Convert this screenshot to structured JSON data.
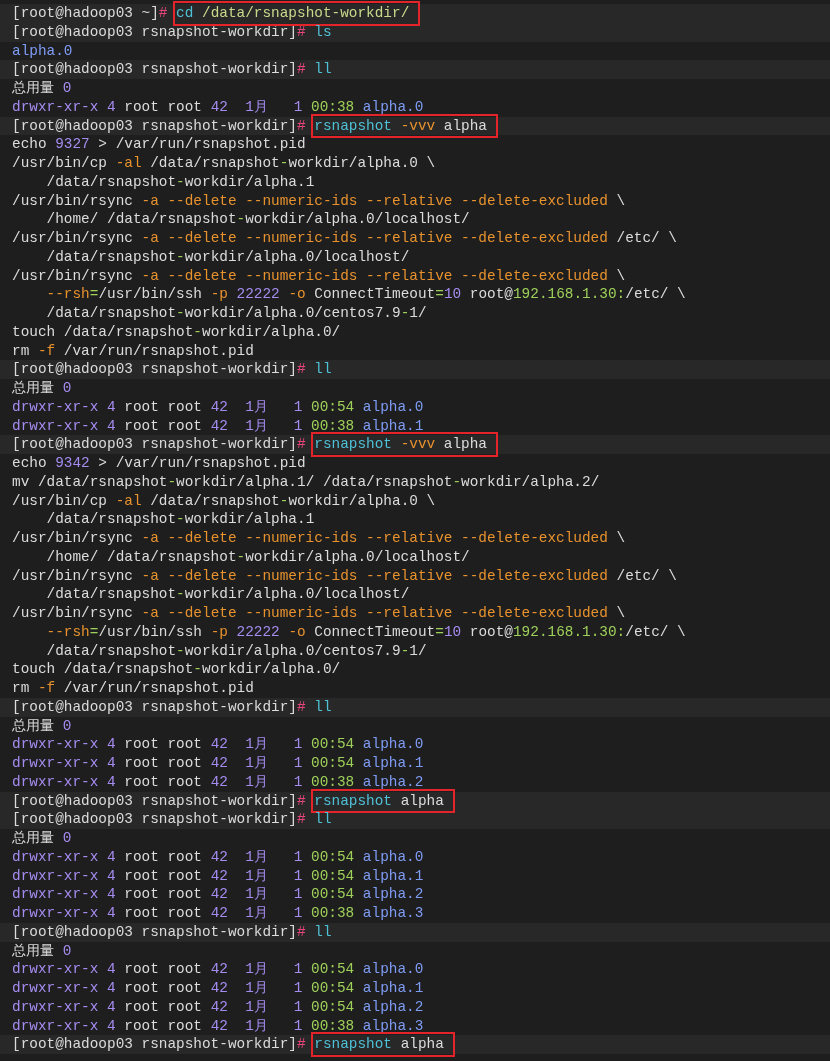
{
  "terminal": {
    "lines": [
      {
        "kind": "prompt",
        "prompt": "[root@hadoop03 ~]",
        "symbol": "#",
        "highlighted": true,
        "command": [
          {
            "text": "cd",
            "color": "#4fc1d6"
          },
          {
            "text": " /data/rsnapshot-workdir/",
            "color": "#c9d98c"
          }
        ]
      },
      {
        "kind": "prompt",
        "prompt": "[root@hadoop03 rsnapshot-workdir]",
        "symbol": "#",
        "highlighted": false,
        "command": [
          {
            "text": "ls",
            "color": "#4fc1d6"
          }
        ]
      },
      {
        "kind": "output",
        "segments": [
          {
            "text": "alpha.0",
            "color": "#7f9cf5"
          }
        ]
      },
      {
        "kind": "prompt",
        "prompt": "[root@hadoop03 rsnapshot-workdir]",
        "symbol": "#",
        "highlighted": false,
        "command": [
          {
            "text": "ll",
            "color": "#4fc1d6"
          }
        ]
      },
      {
        "kind": "output",
        "segments": [
          {
            "text": "总用量"
          },
          {
            "text": " 0",
            "color": "#a58cf0"
          }
        ]
      },
      {
        "kind": "output",
        "segments": [
          {
            "text": "drwxr-xr-x",
            "color": "#a58cf0"
          },
          {
            "text": " 4",
            "color": "#a58cf0"
          },
          {
            "text": " root root"
          },
          {
            "text": " 42",
            "color": "#a58cf0"
          },
          {
            "text": "  1月",
            "color": "#a58cf0"
          },
          {
            "text": "   1",
            "color": "#a58cf0"
          },
          {
            "text": " 00:38",
            "color": "#9fd15a"
          },
          {
            "text": " alpha.0",
            "color": "#7f9cf5"
          }
        ]
      },
      {
        "kind": "prompt",
        "prompt": "[root@hadoop03 rsnapshot-workdir]",
        "symbol": "#",
        "highlighted": true,
        "command": [
          {
            "text": "rsnapshot",
            "color": "#4fc1d6"
          },
          {
            "text": " -vvv",
            "color": "#e8922e"
          },
          {
            "text": " alpha"
          }
        ]
      },
      {
        "kind": "output",
        "segments": [
          {
            "text": "echo"
          },
          {
            "text": " 9327",
            "color": "#a58cf0"
          },
          {
            "text": " > /var/run/rsnapshot.pid"
          }
        ]
      },
      {
        "kind": "output",
        "segments": [
          {
            "text": "/usr/bin/cp"
          },
          {
            "text": " -al",
            "color": "#e8922e"
          },
          {
            "text": " /data/rsnapshot"
          },
          {
            "text": "-",
            "color": "#9fd15a"
          },
          {
            "text": "workdir/alpha.0 \\"
          }
        ]
      },
      {
        "kind": "output",
        "segments": [
          {
            "text": "    /data/rsnapshot"
          },
          {
            "text": "-",
            "color": "#9fd15a"
          },
          {
            "text": "workdir/alpha.1"
          }
        ]
      },
      {
        "kind": "output",
        "segments": [
          {
            "text": "/usr/bin/rsync"
          },
          {
            "text": " -a --delete --numeric-ids --relative --delete-excluded",
            "color": "#e8922e"
          },
          {
            "text": " \\"
          }
        ]
      },
      {
        "kind": "output",
        "segments": [
          {
            "text": "    /home/ /data/rsnapshot"
          },
          {
            "text": "-",
            "color": "#9fd15a"
          },
          {
            "text": "workdir/alpha.0/localhost/"
          }
        ]
      },
      {
        "kind": "output",
        "segments": [
          {
            "text": "/usr/bin/rsync"
          },
          {
            "text": " -a --delete --numeric-ids --relative --delete-excluded",
            "color": "#e8922e"
          },
          {
            "text": " /etc/ \\"
          }
        ]
      },
      {
        "kind": "output",
        "segments": [
          {
            "text": "    /data/rsnapshot"
          },
          {
            "text": "-",
            "color": "#9fd15a"
          },
          {
            "text": "workdir/alpha.0/localhost/"
          }
        ]
      },
      {
        "kind": "output",
        "segments": [
          {
            "text": "/usr/bin/rsync"
          },
          {
            "text": " -a --delete --numeric-ids --relative --delete-excluded",
            "color": "#e8922e"
          },
          {
            "text": " \\"
          }
        ]
      },
      {
        "kind": "output",
        "segments": [
          {
            "text": "    --rsh",
            "color": "#e8922e"
          },
          {
            "text": "=",
            "color": "#9fd15a"
          },
          {
            "text": "/usr/bin/ssh"
          },
          {
            "text": " -p",
            "color": "#e8922e"
          },
          {
            "text": " 22222",
            "color": "#a58cf0"
          },
          {
            "text": " -o",
            "color": "#e8922e"
          },
          {
            "text": " ConnectTimeout"
          },
          {
            "text": "=",
            "color": "#9fd15a"
          },
          {
            "text": "10",
            "color": "#a58cf0"
          },
          {
            "text": " root@"
          },
          {
            "text": "192.168.1.30:",
            "color": "#9fd15a"
          },
          {
            "text": "/etc/ \\"
          }
        ]
      },
      {
        "kind": "output",
        "segments": [
          {
            "text": "    /data/rsnapshot"
          },
          {
            "text": "-",
            "color": "#9fd15a"
          },
          {
            "text": "workdir/alpha.0/centos7.9"
          },
          {
            "text": "-",
            "color": "#9fd15a"
          },
          {
            "text": "1/"
          }
        ]
      },
      {
        "kind": "output",
        "segments": [
          {
            "text": "touch /data/rsnapshot"
          },
          {
            "text": "-",
            "color": "#9fd15a"
          },
          {
            "text": "workdir/alpha.0/"
          }
        ]
      },
      {
        "kind": "output",
        "segments": [
          {
            "text": "rm"
          },
          {
            "text": " -f",
            "color": "#e8922e"
          },
          {
            "text": " /var/run/rsnapshot.pid"
          }
        ]
      },
      {
        "kind": "prompt",
        "prompt": "[root@hadoop03 rsnapshot-workdir]",
        "symbol": "#",
        "highlighted": false,
        "command": [
          {
            "text": "ll",
            "color": "#4fc1d6"
          }
        ]
      },
      {
        "kind": "output",
        "segments": [
          {
            "text": "总用量"
          },
          {
            "text": " 0",
            "color": "#a58cf0"
          }
        ]
      },
      {
        "kind": "output",
        "segments": [
          {
            "text": "drwxr-xr-x",
            "color": "#a58cf0"
          },
          {
            "text": " 4",
            "color": "#a58cf0"
          },
          {
            "text": " root root"
          },
          {
            "text": " 42",
            "color": "#a58cf0"
          },
          {
            "text": "  1月",
            "color": "#a58cf0"
          },
          {
            "text": "   1",
            "color": "#a58cf0"
          },
          {
            "text": " 00:54",
            "color": "#9fd15a"
          },
          {
            "text": " alpha.0",
            "color": "#7f9cf5"
          }
        ]
      },
      {
        "kind": "output",
        "segments": [
          {
            "text": "drwxr-xr-x",
            "color": "#a58cf0"
          },
          {
            "text": " 4",
            "color": "#a58cf0"
          },
          {
            "text": " root root"
          },
          {
            "text": " 42",
            "color": "#a58cf0"
          },
          {
            "text": "  1月",
            "color": "#a58cf0"
          },
          {
            "text": "   1",
            "color": "#a58cf0"
          },
          {
            "text": " 00:38",
            "color": "#9fd15a"
          },
          {
            "text": " alpha.1",
            "color": "#7f9cf5"
          }
        ]
      },
      {
        "kind": "prompt",
        "prompt": "[root@hadoop03 rsnapshot-workdir]",
        "symbol": "#",
        "highlighted": true,
        "command": [
          {
            "text": "rsnapshot",
            "color": "#4fc1d6"
          },
          {
            "text": " -vvv",
            "color": "#e8922e"
          },
          {
            "text": " alpha"
          }
        ]
      },
      {
        "kind": "output",
        "segments": [
          {
            "text": "echo"
          },
          {
            "text": " 9342",
            "color": "#a58cf0"
          },
          {
            "text": " > /var/run/rsnapshot.pid"
          }
        ]
      },
      {
        "kind": "output",
        "segments": [
          {
            "text": "mv /data/rsnapshot"
          },
          {
            "text": "-",
            "color": "#9fd15a"
          },
          {
            "text": "workdir/alpha.1/ /data/rsnapshot"
          },
          {
            "text": "-",
            "color": "#9fd15a"
          },
          {
            "text": "workdir/alpha.2/"
          }
        ]
      },
      {
        "kind": "output",
        "segments": [
          {
            "text": "/usr/bin/cp"
          },
          {
            "text": " -al",
            "color": "#e8922e"
          },
          {
            "text": " /data/rsnapshot"
          },
          {
            "text": "-",
            "color": "#9fd15a"
          },
          {
            "text": "workdir/alpha.0 \\"
          }
        ]
      },
      {
        "kind": "output",
        "segments": [
          {
            "text": "    /data/rsnapshot"
          },
          {
            "text": "-",
            "color": "#9fd15a"
          },
          {
            "text": "workdir/alpha.1"
          }
        ]
      },
      {
        "kind": "output",
        "segments": [
          {
            "text": "/usr/bin/rsync"
          },
          {
            "text": " -a --delete --numeric-ids --relative --delete-excluded",
            "color": "#e8922e"
          },
          {
            "text": " \\"
          }
        ]
      },
      {
        "kind": "output",
        "segments": [
          {
            "text": "    /home/ /data/rsnapshot"
          },
          {
            "text": "-",
            "color": "#9fd15a"
          },
          {
            "text": "workdir/alpha.0/localhost/"
          }
        ]
      },
      {
        "kind": "output",
        "segments": [
          {
            "text": "/usr/bin/rsync"
          },
          {
            "text": " -a --delete --numeric-ids --relative --delete-excluded",
            "color": "#e8922e"
          },
          {
            "text": " /etc/ \\"
          }
        ]
      },
      {
        "kind": "output",
        "segments": [
          {
            "text": "    /data/rsnapshot"
          },
          {
            "text": "-",
            "color": "#9fd15a"
          },
          {
            "text": "workdir/alpha.0/localhost/"
          }
        ]
      },
      {
        "kind": "output",
        "segments": [
          {
            "text": "/usr/bin/rsync"
          },
          {
            "text": " -a --delete --numeric-ids --relative --delete-excluded",
            "color": "#e8922e"
          },
          {
            "text": " \\"
          }
        ]
      },
      {
        "kind": "output",
        "segments": [
          {
            "text": "    --rsh",
            "color": "#e8922e"
          },
          {
            "text": "=",
            "color": "#9fd15a"
          },
          {
            "text": "/usr/bin/ssh"
          },
          {
            "text": " -p",
            "color": "#e8922e"
          },
          {
            "text": " 22222",
            "color": "#a58cf0"
          },
          {
            "text": " -o",
            "color": "#e8922e"
          },
          {
            "text": " ConnectTimeout"
          },
          {
            "text": "=",
            "color": "#9fd15a"
          },
          {
            "text": "10",
            "color": "#a58cf0"
          },
          {
            "text": " root@"
          },
          {
            "text": "192.168.1.30:",
            "color": "#9fd15a"
          },
          {
            "text": "/etc/ \\"
          }
        ]
      },
      {
        "kind": "output",
        "segments": [
          {
            "text": "    /data/rsnapshot"
          },
          {
            "text": "-",
            "color": "#9fd15a"
          },
          {
            "text": "workdir/alpha.0/centos7.9"
          },
          {
            "text": "-",
            "color": "#9fd15a"
          },
          {
            "text": "1/"
          }
        ]
      },
      {
        "kind": "output",
        "segments": [
          {
            "text": "touch /data/rsnapshot"
          },
          {
            "text": "-",
            "color": "#9fd15a"
          },
          {
            "text": "workdir/alpha.0/"
          }
        ]
      },
      {
        "kind": "output",
        "segments": [
          {
            "text": "rm"
          },
          {
            "text": " -f",
            "color": "#e8922e"
          },
          {
            "text": " /var/run/rsnapshot.pid"
          }
        ]
      },
      {
        "kind": "prompt",
        "prompt": "[root@hadoop03 rsnapshot-workdir]",
        "symbol": "#",
        "highlighted": false,
        "command": [
          {
            "text": "ll",
            "color": "#4fc1d6"
          }
        ]
      },
      {
        "kind": "output",
        "segments": [
          {
            "text": "总用量"
          },
          {
            "text": " 0",
            "color": "#a58cf0"
          }
        ]
      },
      {
        "kind": "output",
        "segments": [
          {
            "text": "drwxr-xr-x",
            "color": "#a58cf0"
          },
          {
            "text": " 4",
            "color": "#a58cf0"
          },
          {
            "text": " root root"
          },
          {
            "text": " 42",
            "color": "#a58cf0"
          },
          {
            "text": "  1月",
            "color": "#a58cf0"
          },
          {
            "text": "   1",
            "color": "#a58cf0"
          },
          {
            "text": " 00:54",
            "color": "#9fd15a"
          },
          {
            "text": " alpha.0",
            "color": "#7f9cf5"
          }
        ]
      },
      {
        "kind": "output",
        "segments": [
          {
            "text": "drwxr-xr-x",
            "color": "#a58cf0"
          },
          {
            "text": " 4",
            "color": "#a58cf0"
          },
          {
            "text": " root root"
          },
          {
            "text": " 42",
            "color": "#a58cf0"
          },
          {
            "text": "  1月",
            "color": "#a58cf0"
          },
          {
            "text": "   1",
            "color": "#a58cf0"
          },
          {
            "text": " 00:54",
            "color": "#9fd15a"
          },
          {
            "text": " alpha.1",
            "color": "#7f9cf5"
          }
        ]
      },
      {
        "kind": "output",
        "segments": [
          {
            "text": "drwxr-xr-x",
            "color": "#a58cf0"
          },
          {
            "text": " 4",
            "color": "#a58cf0"
          },
          {
            "text": " root root"
          },
          {
            "text": " 42",
            "color": "#a58cf0"
          },
          {
            "text": "  1月",
            "color": "#a58cf0"
          },
          {
            "text": "   1",
            "color": "#a58cf0"
          },
          {
            "text": " 00:38",
            "color": "#9fd15a"
          },
          {
            "text": " alpha.2",
            "color": "#7f9cf5"
          }
        ]
      },
      {
        "kind": "prompt",
        "prompt": "[root@hadoop03 rsnapshot-workdir]",
        "symbol": "#",
        "highlighted": true,
        "command": [
          {
            "text": "rsnapshot",
            "color": "#4fc1d6"
          },
          {
            "text": " alpha"
          }
        ]
      },
      {
        "kind": "prompt",
        "prompt": "[root@hadoop03 rsnapshot-workdir]",
        "symbol": "#",
        "highlighted": false,
        "command": [
          {
            "text": "ll",
            "color": "#4fc1d6"
          }
        ]
      },
      {
        "kind": "output",
        "segments": [
          {
            "text": "总用量"
          },
          {
            "text": " 0",
            "color": "#a58cf0"
          }
        ]
      },
      {
        "kind": "output",
        "segments": [
          {
            "text": "drwxr-xr-x",
            "color": "#a58cf0"
          },
          {
            "text": " 4",
            "color": "#a58cf0"
          },
          {
            "text": " root root"
          },
          {
            "text": " 42",
            "color": "#a58cf0"
          },
          {
            "text": "  1月",
            "color": "#a58cf0"
          },
          {
            "text": "   1",
            "color": "#a58cf0"
          },
          {
            "text": " 00:54",
            "color": "#9fd15a"
          },
          {
            "text": " alpha.0",
            "color": "#7f9cf5"
          }
        ]
      },
      {
        "kind": "output",
        "segments": [
          {
            "text": "drwxr-xr-x",
            "color": "#a58cf0"
          },
          {
            "text": " 4",
            "color": "#a58cf0"
          },
          {
            "text": " root root"
          },
          {
            "text": " 42",
            "color": "#a58cf0"
          },
          {
            "text": "  1月",
            "color": "#a58cf0"
          },
          {
            "text": "   1",
            "color": "#a58cf0"
          },
          {
            "text": " 00:54",
            "color": "#9fd15a"
          },
          {
            "text": " alpha.1",
            "color": "#7f9cf5"
          }
        ]
      },
      {
        "kind": "output",
        "segments": [
          {
            "text": "drwxr-xr-x",
            "color": "#a58cf0"
          },
          {
            "text": " 4",
            "color": "#a58cf0"
          },
          {
            "text": " root root"
          },
          {
            "text": " 42",
            "color": "#a58cf0"
          },
          {
            "text": "  1月",
            "color": "#a58cf0"
          },
          {
            "text": "   1",
            "color": "#a58cf0"
          },
          {
            "text": " 00:54",
            "color": "#9fd15a"
          },
          {
            "text": " alpha.2",
            "color": "#7f9cf5"
          }
        ]
      },
      {
        "kind": "output",
        "segments": [
          {
            "text": "drwxr-xr-x",
            "color": "#a58cf0"
          },
          {
            "text": " 4",
            "color": "#a58cf0"
          },
          {
            "text": " root root"
          },
          {
            "text": " 42",
            "color": "#a58cf0"
          },
          {
            "text": "  1月",
            "color": "#a58cf0"
          },
          {
            "text": "   1",
            "color": "#a58cf0"
          },
          {
            "text": " 00:38",
            "color": "#9fd15a"
          },
          {
            "text": " alpha.3",
            "color": "#7f9cf5"
          }
        ]
      },
      {
        "kind": "prompt",
        "prompt": "[root@hadoop03 rsnapshot-workdir]",
        "symbol": "#",
        "highlighted": false,
        "command": [
          {
            "text": "ll",
            "color": "#4fc1d6"
          }
        ]
      },
      {
        "kind": "output",
        "segments": [
          {
            "text": "总用量"
          },
          {
            "text": " 0",
            "color": "#a58cf0"
          }
        ]
      },
      {
        "kind": "output",
        "segments": [
          {
            "text": "drwxr-xr-x",
            "color": "#a58cf0"
          },
          {
            "text": " 4",
            "color": "#a58cf0"
          },
          {
            "text": " root root"
          },
          {
            "text": " 42",
            "color": "#a58cf0"
          },
          {
            "text": "  1月",
            "color": "#a58cf0"
          },
          {
            "text": "   1",
            "color": "#a58cf0"
          },
          {
            "text": " 00:54",
            "color": "#9fd15a"
          },
          {
            "text": " alpha.0",
            "color": "#7f9cf5"
          }
        ]
      },
      {
        "kind": "output",
        "segments": [
          {
            "text": "drwxr-xr-x",
            "color": "#a58cf0"
          },
          {
            "text": " 4",
            "color": "#a58cf0"
          },
          {
            "text": " root root"
          },
          {
            "text": " 42",
            "color": "#a58cf0"
          },
          {
            "text": "  1月",
            "color": "#a58cf0"
          },
          {
            "text": "   1",
            "color": "#a58cf0"
          },
          {
            "text": " 00:54",
            "color": "#9fd15a"
          },
          {
            "text": " alpha.1",
            "color": "#7f9cf5"
          }
        ]
      },
      {
        "kind": "output",
        "segments": [
          {
            "text": "drwxr-xr-x",
            "color": "#a58cf0"
          },
          {
            "text": " 4",
            "color": "#a58cf0"
          },
          {
            "text": " root root"
          },
          {
            "text": " 42",
            "color": "#a58cf0"
          },
          {
            "text": "  1月",
            "color": "#a58cf0"
          },
          {
            "text": "   1",
            "color": "#a58cf0"
          },
          {
            "text": " 00:54",
            "color": "#9fd15a"
          },
          {
            "text": " alpha.2",
            "color": "#7f9cf5"
          }
        ]
      },
      {
        "kind": "output",
        "segments": [
          {
            "text": "drwxr-xr-x",
            "color": "#a58cf0"
          },
          {
            "text": " 4",
            "color": "#a58cf0"
          },
          {
            "text": " root root"
          },
          {
            "text": " 42",
            "color": "#a58cf0"
          },
          {
            "text": "  1月",
            "color": "#a58cf0"
          },
          {
            "text": "   1",
            "color": "#a58cf0"
          },
          {
            "text": " 00:38",
            "color": "#9fd15a"
          },
          {
            "text": " alpha.3",
            "color": "#7f9cf5"
          }
        ]
      },
      {
        "kind": "prompt",
        "prompt": "[root@hadoop03 rsnapshot-workdir]",
        "symbol": "#",
        "highlighted": true,
        "command": [
          {
            "text": "rsnapshot",
            "color": "#4fc1d6"
          },
          {
            "text": " alpha"
          }
        ]
      }
    ]
  }
}
